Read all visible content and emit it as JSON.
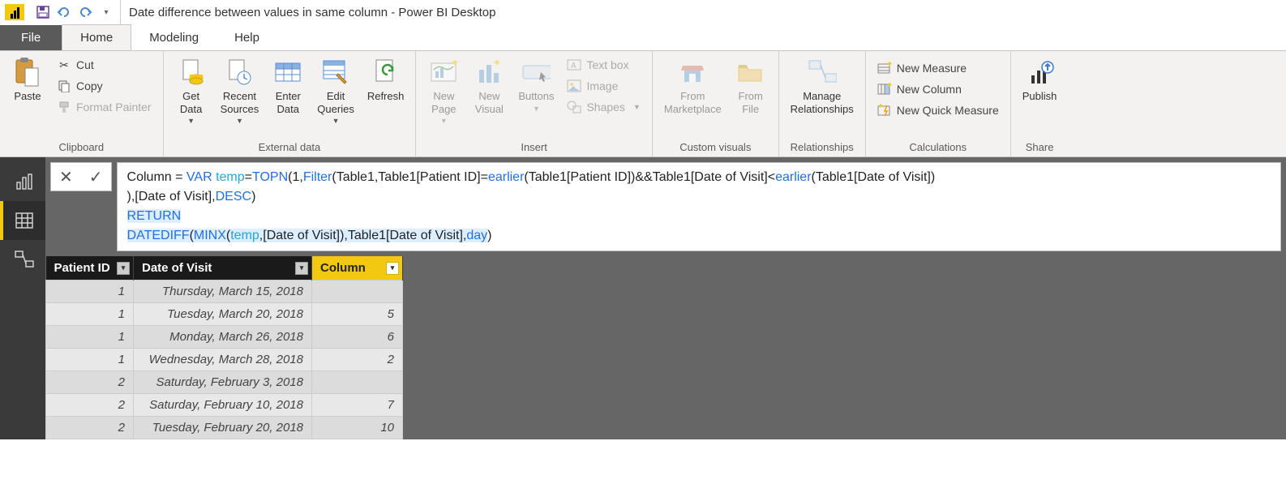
{
  "title": "Date difference between values in same column - Power BI Desktop",
  "tabs": {
    "file": "File",
    "home": "Home",
    "modeling": "Modeling",
    "help": "Help"
  },
  "ribbon": {
    "clipboard": {
      "label": "Clipboard",
      "paste": "Paste",
      "cut": "Cut",
      "copy": "Copy",
      "format_painter": "Format Painter"
    },
    "external": {
      "label": "External data",
      "get_data": "Get\nData",
      "recent": "Recent\nSources",
      "enter": "Enter\nData",
      "edit": "Edit\nQueries",
      "refresh": "Refresh"
    },
    "insert": {
      "label": "Insert",
      "new_page": "New\nPage",
      "new_visual": "New\nVisual",
      "buttons": "Buttons",
      "textbox": "Text box",
      "image": "Image",
      "shapes": "Shapes"
    },
    "custom": {
      "label": "Custom visuals",
      "marketplace": "From\nMarketplace",
      "file": "From\nFile"
    },
    "rel": {
      "label": "Relationships",
      "manage": "Manage\nRelationships"
    },
    "calc": {
      "label": "Calculations",
      "measure": "New Measure",
      "column": "New Column",
      "quick": "New Quick Measure"
    },
    "share": {
      "label": "Share",
      "publish": "Publish"
    }
  },
  "formula": {
    "line1_pre": "Column = ",
    "var_kw": "VAR ",
    "temp": "temp",
    "eq": "=",
    "topn": "TOPN",
    "l1a": "(1,",
    "filter": "Filter",
    "l1b": "(Table1,Table1[Patient ID]=",
    "earlier1": "earlier",
    "l1c": "(Table1[Patient ID])&&Table1[Date of Visit]<",
    "earlier2": "earlier",
    "l1d": "(Table1[Date of Visit])",
    "line2a": "),[Date of Visit],",
    "desc": "DESC",
    "line2b": ")",
    "return": "RETURN",
    "datediff": "DATEDIFF",
    "l4a": "(",
    "minx": "MINX",
    "l4b": "(",
    "temp2": "temp",
    "l4c": ",[Date of Visit]),Table1[Date of Visit],",
    "day": "day",
    "l4d": ")"
  },
  "table": {
    "cols": [
      "Patient ID",
      "Date of Visit",
      "Column"
    ],
    "rows": [
      {
        "pid": "1",
        "dov": "Thursday, March 15, 2018",
        "col": ""
      },
      {
        "pid": "1",
        "dov": "Tuesday, March 20, 2018",
        "col": "5"
      },
      {
        "pid": "1",
        "dov": "Monday, March 26, 2018",
        "col": "6"
      },
      {
        "pid": "1",
        "dov": "Wednesday, March 28, 2018",
        "col": "2"
      },
      {
        "pid": "2",
        "dov": "Saturday, February 3, 2018",
        "col": ""
      },
      {
        "pid": "2",
        "dov": "Saturday, February 10, 2018",
        "col": "7"
      },
      {
        "pid": "2",
        "dov": "Tuesday, February 20, 2018",
        "col": "10"
      }
    ]
  }
}
